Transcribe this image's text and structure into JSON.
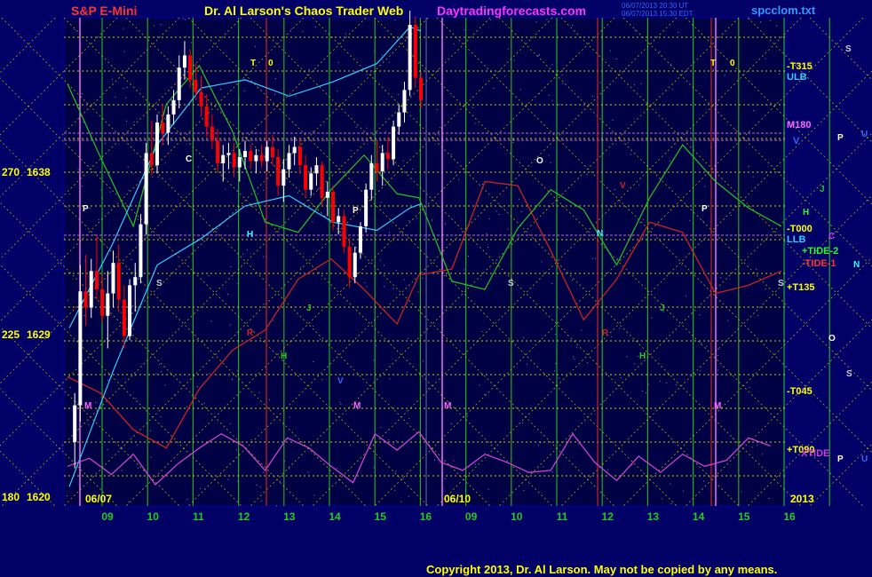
{
  "header": {
    "left": "S&P E-Mini",
    "center": "Dr. Al Larson's Chaos Trader Web",
    "site": "Daytradingforecasts.com",
    "file": "spcclom.txt",
    "stamp_line1": "06/07/2013 20:30 UT",
    "stamp_line2": "06/07/2013 15:30 EDT"
  },
  "copyright": "Copyright 2013, Dr. Al Larson. May not be copied by any means.",
  "colors": {
    "background": "#000066",
    "price_up": "#ffffff",
    "price_down": "#ff0000",
    "tide1": "#cc2222",
    "tide2": "#22bb22",
    "band": "#33ccff",
    "xtide": "#cc44cc",
    "grid_green": "#22aa22",
    "grid_yellow": "#cccc00",
    "grid_magenta": "#cc66cc",
    "grid_red": "#cc2222"
  },
  "chart_data": {
    "type": "line",
    "title": "S&P E-Mini",
    "y_labels": [
      {
        "angle": "270",
        "price": "1638"
      },
      {
        "angle": "225",
        "price": "1629"
      },
      {
        "angle": "180",
        "price": "1620"
      }
    ],
    "ylim": [
      1620,
      1644
    ],
    "x_day_labels": [
      "09",
      "10",
      "11",
      "12",
      "13",
      "14",
      "15",
      "16",
      "09",
      "10",
      "11",
      "12",
      "13",
      "14",
      "15",
      "16"
    ],
    "date_labels": [
      "06/07",
      "06/10",
      "2013"
    ],
    "right_labels": [
      "-T315",
      "ULB",
      "M180",
      "V",
      "-T000",
      "LLB",
      "+TIDE-2",
      "-TIDE-1",
      "+T135",
      "-T045",
      "+T090",
      "XTIDE"
    ],
    "far_right_letters": [
      "S",
      "P",
      "U",
      "J",
      "H",
      "C",
      "N",
      "O",
      "S",
      "P",
      "U"
    ],
    "chart_letters": [
      "T",
      "0",
      "T",
      "0",
      "O",
      "P",
      "P",
      "C",
      "H",
      "N",
      "S",
      "S",
      "S",
      "J",
      "J",
      "R",
      "R",
      "H",
      "H",
      "V",
      "M",
      "M",
      "M",
      "M",
      "P",
      "V"
    ],
    "price_series": [
      {
        "t": 0.5,
        "o": 1622.8,
        "h": 1625.2,
        "l": 1621.5,
        "c": 1624.6
      },
      {
        "t": 1.0,
        "o": 1624.6,
        "h": 1631.5,
        "l": 1623.8,
        "c": 1630.2
      },
      {
        "t": 1.5,
        "o": 1630.2,
        "h": 1632.0,
        "l": 1628.5,
        "c": 1629.4
      },
      {
        "t": 2.0,
        "o": 1629.4,
        "h": 1631.8,
        "l": 1628.9,
        "c": 1631.2
      },
      {
        "t": 2.5,
        "o": 1631.2,
        "h": 1632.9,
        "l": 1629.8,
        "c": 1630.3
      },
      {
        "t": 3.0,
        "o": 1630.3,
        "h": 1631.0,
        "l": 1628.7,
        "c": 1629.0
      },
      {
        "t": 3.5,
        "o": 1629.0,
        "h": 1631.2,
        "l": 1627.4,
        "c": 1630.1
      },
      {
        "t": 4.0,
        "o": 1630.1,
        "h": 1632.2,
        "l": 1629.4,
        "c": 1631.6
      },
      {
        "t": 4.5,
        "o": 1631.6,
        "h": 1632.5,
        "l": 1629.2,
        "c": 1629.8
      },
      {
        "t": 5.0,
        "o": 1629.8,
        "h": 1630.5,
        "l": 1627.4,
        "c": 1628.0
      },
      {
        "t": 5.5,
        "o": 1628.0,
        "h": 1630.8,
        "l": 1627.8,
        "c": 1630.5
      },
      {
        "t": 6.0,
        "o": 1630.5,
        "h": 1631.6,
        "l": 1629.2,
        "c": 1630.9
      },
      {
        "t": 6.5,
        "o": 1630.9,
        "h": 1634.0,
        "l": 1630.6,
        "c": 1633.5
      },
      {
        "t": 7.0,
        "o": 1633.5,
        "h": 1637.5,
        "l": 1633.0,
        "c": 1637.0
      },
      {
        "t": 7.5,
        "o": 1637.0,
        "h": 1638.6,
        "l": 1635.9,
        "c": 1636.4
      },
      {
        "t": 8.0,
        "o": 1636.4,
        "h": 1638.9,
        "l": 1636.0,
        "c": 1638.5
      },
      {
        "t": 8.5,
        "o": 1638.5,
        "h": 1639.4,
        "l": 1637.4,
        "c": 1638.0
      },
      {
        "t": 9.0,
        "o": 1638.0,
        "h": 1639.3,
        "l": 1637.4,
        "c": 1638.9
      },
      {
        "t": 9.5,
        "o": 1638.9,
        "h": 1640.1,
        "l": 1638.4,
        "c": 1639.6
      },
      {
        "t": 10.0,
        "o": 1639.6,
        "h": 1641.8,
        "l": 1639.2,
        "c": 1641.2
      },
      {
        "t": 10.5,
        "o": 1641.2,
        "h": 1642.5,
        "l": 1640.6,
        "c": 1641.8
      },
      {
        "t": 11.0,
        "o": 1641.8,
        "h": 1642.1,
        "l": 1640.2,
        "c": 1640.6
      },
      {
        "t": 11.5,
        "o": 1640.6,
        "h": 1641.4,
        "l": 1639.6,
        "c": 1640.0
      },
      {
        "t": 12.0,
        "o": 1640.0,
        "h": 1640.8,
        "l": 1638.8,
        "c": 1639.3
      },
      {
        "t": 12.5,
        "o": 1639.3,
        "h": 1639.9,
        "l": 1637.8,
        "c": 1638.3
      },
      {
        "t": 13.0,
        "o": 1638.3,
        "h": 1638.9,
        "l": 1637.2,
        "c": 1637.6
      },
      {
        "t": 13.5,
        "o": 1637.6,
        "h": 1638.2,
        "l": 1636.1,
        "c": 1636.5
      },
      {
        "t": 14.0,
        "o": 1636.5,
        "h": 1637.4,
        "l": 1635.6,
        "c": 1636.9
      },
      {
        "t": 14.5,
        "o": 1636.9,
        "h": 1637.5,
        "l": 1636.2,
        "c": 1637.0
      },
      {
        "t": 15.0,
        "o": 1637.0,
        "h": 1637.5,
        "l": 1635.8,
        "c": 1636.3
      },
      {
        "t": 15.5,
        "o": 1636.3,
        "h": 1637.2,
        "l": 1635.6,
        "c": 1636.8
      },
      {
        "t": 16.0,
        "o": 1636.8,
        "h": 1637.6,
        "l": 1636.2,
        "c": 1637.1
      },
      {
        "t": 16.5,
        "o": 1637.1,
        "h": 1637.4,
        "l": 1636.2,
        "c": 1636.6
      },
      {
        "t": 17.0,
        "o": 1636.6,
        "h": 1637.2,
        "l": 1636.0,
        "c": 1636.9
      },
      {
        "t": 17.5,
        "o": 1636.9,
        "h": 1637.4,
        "l": 1636.3,
        "c": 1636.6
      },
      {
        "t": 18.0,
        "o": 1636.6,
        "h": 1637.6,
        "l": 1636.1,
        "c": 1637.3
      },
      {
        "t": 18.5,
        "o": 1637.3,
        "h": 1637.9,
        "l": 1636.4,
        "c": 1636.8
      },
      {
        "t": 19.0,
        "o": 1636.8,
        "h": 1637.2,
        "l": 1634.9,
        "c": 1635.4
      },
      {
        "t": 19.5,
        "o": 1635.4,
        "h": 1636.7,
        "l": 1634.6,
        "c": 1636.2
      },
      {
        "t": 20.0,
        "o": 1636.2,
        "h": 1637.4,
        "l": 1635.8,
        "c": 1637.0
      },
      {
        "t": 20.5,
        "o": 1637.0,
        "h": 1637.8,
        "l": 1636.4,
        "c": 1637.3
      },
      {
        "t": 21.0,
        "o": 1637.3,
        "h": 1637.7,
        "l": 1636.0,
        "c": 1636.4
      },
      {
        "t": 21.5,
        "o": 1636.4,
        "h": 1636.9,
        "l": 1634.8,
        "c": 1635.2
      },
      {
        "t": 22.0,
        "o": 1635.2,
        "h": 1636.3,
        "l": 1634.9,
        "c": 1636.0
      },
      {
        "t": 22.5,
        "o": 1636.0,
        "h": 1636.8,
        "l": 1635.4,
        "c": 1636.4
      },
      {
        "t": 23.0,
        "o": 1636.4,
        "h": 1636.6,
        "l": 1634.4,
        "c": 1634.8
      },
      {
        "t": 23.5,
        "o": 1634.8,
        "h": 1635.6,
        "l": 1633.9,
        "c": 1635.1
      },
      {
        "t": 24.0,
        "o": 1635.1,
        "h": 1635.4,
        "l": 1633.2,
        "c": 1633.6
      },
      {
        "t": 24.5,
        "o": 1633.6,
        "h": 1634.3,
        "l": 1633.0,
        "c": 1633.9
      },
      {
        "t": 25.0,
        "o": 1633.9,
        "h": 1634.2,
        "l": 1632.1,
        "c": 1632.4
      },
      {
        "t": 25.5,
        "o": 1632.4,
        "h": 1632.8,
        "l": 1630.4,
        "c": 1630.9
      },
      {
        "t": 26.0,
        "o": 1630.9,
        "h": 1632.4,
        "l": 1630.6,
        "c": 1632.1
      },
      {
        "t": 26.5,
        "o": 1632.1,
        "h": 1633.6,
        "l": 1631.8,
        "c": 1633.4
      },
      {
        "t": 27.0,
        "o": 1633.4,
        "h": 1635.5,
        "l": 1633.1,
        "c": 1635.2
      },
      {
        "t": 27.5,
        "o": 1635.2,
        "h": 1636.9,
        "l": 1634.7,
        "c": 1636.5
      },
      {
        "t": 28.0,
        "o": 1636.5,
        "h": 1637.6,
        "l": 1635.6,
        "c": 1636.1
      },
      {
        "t": 28.5,
        "o": 1636.1,
        "h": 1637.4,
        "l": 1635.4,
        "c": 1637.0
      },
      {
        "t": 29.0,
        "o": 1637.0,
        "h": 1637.8,
        "l": 1636.2,
        "c": 1636.7
      },
      {
        "t": 29.5,
        "o": 1636.7,
        "h": 1638.6,
        "l": 1636.4,
        "c": 1638.3
      },
      {
        "t": 30.0,
        "o": 1638.3,
        "h": 1639.4,
        "l": 1637.9,
        "c": 1639.0
      },
      {
        "t": 30.5,
        "o": 1639.0,
        "h": 1640.5,
        "l": 1638.5,
        "c": 1640.1
      },
      {
        "t": 31.0,
        "o": 1640.1,
        "h": 1644.0,
        "l": 1639.8,
        "c": 1643.3
      },
      {
        "t": 31.5,
        "o": 1643.3,
        "h": 1643.7,
        "l": 1640.2,
        "c": 1640.7
      },
      {
        "t": 32.0,
        "o": 1640.7,
        "h": 1641.0,
        "l": 1639.2,
        "c": 1639.6
      }
    ],
    "tide1": [
      [
        0,
        1626
      ],
      [
        3,
        1625.2
      ],
      [
        6,
        1623.4
      ],
      [
        9,
        1622.5
      ],
      [
        12,
        1625.4
      ],
      [
        15,
        1627.3
      ],
      [
        18,
        1628.3
      ],
      [
        21,
        1630.8
      ],
      [
        24,
        1631.8
      ],
      [
        27,
        1630.3
      ],
      [
        30,
        1628.6
      ],
      [
        32,
        1631
      ],
      [
        35,
        1631.3
      ],
      [
        38,
        1635.6
      ],
      [
        41,
        1635.4
      ],
      [
        44,
        1632.2
      ],
      [
        47,
        1628.8
      ],
      [
        50,
        1630.8
      ],
      [
        53,
        1633.6
      ],
      [
        56,
        1633.1
      ],
      [
        59,
        1630.1
      ],
      [
        62,
        1630.5
      ],
      [
        65,
        1631.2
      ]
    ],
    "tide2": [
      [
        0,
        1640.4
      ],
      [
        3,
        1636.8
      ],
      [
        6,
        1633.4
      ],
      [
        9,
        1639.4
      ],
      [
        12,
        1641.3
      ],
      [
        15,
        1638.1
      ],
      [
        18,
        1633.6
      ],
      [
        21,
        1633.1
      ],
      [
        24,
        1635.2
      ],
      [
        27,
        1636.9
      ],
      [
        30,
        1635.0
      ],
      [
        32,
        1634.8
      ],
      [
        35,
        1630.7
      ],
      [
        38,
        1630.3
      ],
      [
        41,
        1633.3
      ],
      [
        44,
        1635.2
      ],
      [
        47,
        1634.2
      ],
      [
        50,
        1631.5
      ],
      [
        53,
        1634.8
      ],
      [
        56,
        1637.4
      ],
      [
        59,
        1635.6
      ],
      [
        62,
        1634.3
      ],
      [
        65,
        1633.4
      ]
    ],
    "upper_band": [
      [
        0,
        1628.4
      ],
      [
        4,
        1632.6
      ],
      [
        8,
        1637.4
      ],
      [
        12,
        1640.2
      ],
      [
        16,
        1640.6
      ],
      [
        20,
        1639.8
      ],
      [
        24,
        1640.5
      ],
      [
        28,
        1641.4
      ],
      [
        31,
        1643.2
      ],
      [
        32,
        1643.0
      ]
    ],
    "lower_band": [
      [
        0,
        1620.6
      ],
      [
        4,
        1626.3
      ],
      [
        8,
        1631.5
      ],
      [
        12,
        1632.8
      ],
      [
        16,
        1634.4
      ],
      [
        20,
        1634.9
      ],
      [
        24,
        1633.6
      ],
      [
        28,
        1633.2
      ],
      [
        31,
        1634.3
      ],
      [
        32,
        1634.5
      ]
    ],
    "xtide": [
      [
        0,
        1621.6
      ],
      [
        2,
        1622.0
      ],
      [
        4,
        1621.2
      ],
      [
        6,
        1622.2
      ],
      [
        8,
        1620.7
      ],
      [
        10,
        1621.7
      ],
      [
        12,
        1622.5
      ],
      [
        14,
        1623.2
      ],
      [
        16,
        1622.6
      ],
      [
        18,
        1621.4
      ],
      [
        20,
        1623.0
      ],
      [
        22,
        1622.5
      ],
      [
        24,
        1621.6
      ],
      [
        26,
        1620.8
      ],
      [
        28,
        1623.2
      ],
      [
        30,
        1622.4
      ],
      [
        32,
        1623.3
      ],
      [
        34,
        1621.8
      ],
      [
        36,
        1621.4
      ],
      [
        38,
        1622.2
      ],
      [
        40,
        1621.8
      ],
      [
        42,
        1621.3
      ],
      [
        44,
        1621.4
      ],
      [
        46,
        1623.2
      ],
      [
        48,
        1621.8
      ],
      [
        50,
        1620.9
      ],
      [
        52,
        1622.1
      ],
      [
        54,
        1621.3
      ],
      [
        56,
        1622.2
      ],
      [
        58,
        1621.6
      ],
      [
        60,
        1621.9
      ],
      [
        62,
        1623.0
      ],
      [
        64,
        1622.6
      ]
    ]
  }
}
